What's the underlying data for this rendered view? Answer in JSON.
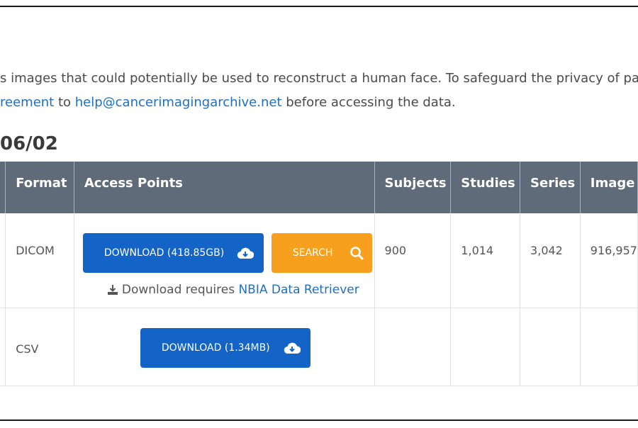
{
  "intro": {
    "line1": "s images that could potentially be used to reconstruct a human face. To safeguard the privacy of pa",
    "agreement_link": "reement",
    "to_text": " to ",
    "email_link": "help@cancerimagingarchive.net",
    "line2_tail": " before accessing the data."
  },
  "version_heading": "06/02",
  "table": {
    "headers": {
      "format": "Format",
      "access": "Access Points",
      "subjects": "Subjects",
      "studies": "Studies",
      "series": "Series",
      "images": "Image"
    },
    "rows": [
      {
        "format": "DICOM",
        "download_label": "DOWNLOAD (418.85GB)",
        "search_label": "SEARCH",
        "requires_text": "Download requires ",
        "requires_link": "NBIA Data Retriever",
        "subjects": "900",
        "studies": "1,014",
        "series": "3,042",
        "images": "916,957"
      },
      {
        "format": "CSV",
        "download_label": "DOWNLOAD (1.34MB)"
      }
    ]
  },
  "icons": {
    "cloud_download": "cloud-download-icon",
    "search": "search-icon",
    "download_tray": "download-tray-icon"
  },
  "colors": {
    "header_bg": "#5f6b78",
    "download_button": "#1463c7",
    "search_button": "#f7a01d",
    "link": "#1f6fbf"
  }
}
